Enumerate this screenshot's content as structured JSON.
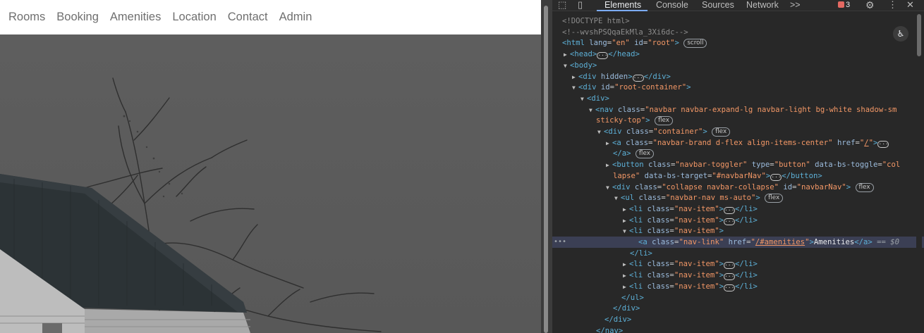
{
  "site": {
    "nav_links": [
      {
        "label": "Rooms"
      },
      {
        "label": "Booking"
      },
      {
        "label": "Amenities"
      },
      {
        "label": "Location"
      },
      {
        "label": "Contact"
      },
      {
        "label": "Admin"
      }
    ]
  },
  "devtools": {
    "tabs": [
      {
        "label": "Elements",
        "active": true
      },
      {
        "label": "Console"
      },
      {
        "label": "Sources"
      },
      {
        "label": "Network"
      },
      {
        "label": ">>"
      }
    ],
    "issues_count": "3",
    "icons": {
      "inspect": "inspect-icon",
      "device": "device-toggle-icon",
      "settings": "gear-icon",
      "more": "kebab-menu-icon",
      "close": "close-icon",
      "accessibility": "accessibility-icon"
    },
    "colors": {
      "selected_row": "#3b3f54",
      "tag": "#5db0d7",
      "attr_name": "#9bbbdc",
      "attr_value": "#f29766",
      "panel_bg": "#282828"
    },
    "tree": [
      {
        "indent": 0,
        "tri": "",
        "html": "<span class='cm'>&lt;!DOCTYPE html&gt;</span>"
      },
      {
        "indent": 0,
        "tri": "",
        "html": "<span class='cm'>&lt;!--wvshPSQqaEkMla_3Xi6dc--&gt;</span>"
      },
      {
        "indent": 0,
        "tri": "",
        "html": "<span class='tg'>&lt;html</span> <span class='an'>lang</span>=<span class='av'>\"en\"</span> <span class='an'>id</span>=<span class='av'>\"root\"</span><span class='tg'>&gt;</span> <span class='pill'>scroll</span>"
      },
      {
        "indent": 1,
        "tri": "▶",
        "html": "<span class='tg'>&lt;head&gt;</span><span class='dots'>···</span><span class='tg'>&lt;/head&gt;</span>"
      },
      {
        "indent": 1,
        "tri": "▼",
        "html": "<span class='tg'>&lt;body&gt;</span>"
      },
      {
        "indent": 2,
        "tri": "▶",
        "html": "<span class='tg'>&lt;div</span> <span class='an'>hidden</span><span class='tg'>&gt;</span><span class='dots'>···</span><span class='tg'>&lt;/div&gt;</span>"
      },
      {
        "indent": 2,
        "tri": "▼",
        "html": "<span class='tg'>&lt;div</span> <span class='an'>id</span>=<span class='av'>\"root-container\"</span><span class='tg'>&gt;</span>"
      },
      {
        "indent": 3,
        "tri": "▼",
        "html": "<span class='tg'>&lt;div&gt;</span>"
      },
      {
        "indent": 4,
        "tri": "▼",
        "html": "<span class='tg'>&lt;nav</span> <span class='an'>class</span>=<span class='av'>\"navbar navbar-expand-lg navbar-light bg-white shadow-sm</span>"
      },
      {
        "indent": 4,
        "tri": "",
        "html": "<span class='av'>sticky-top\"</span><span class='tg'>&gt;</span> <span class='pill'>flex</span>"
      },
      {
        "indent": 5,
        "tri": "▼",
        "html": "<span class='tg'>&lt;div</span> <span class='an'>class</span>=<span class='av'>\"container\"</span><span class='tg'>&gt;</span> <span class='pill'>flex</span>"
      },
      {
        "indent": 6,
        "tri": "▶",
        "html": "<span class='tg'>&lt;a</span> <span class='an'>class</span>=<span class='av'>\"navbar-brand d-flex align-items-center\"</span> <span class='an'>href</span>=<span class='av'>\"</span><span class='lk'>/</span><span class='av'>\"</span><span class='tg'>&gt;</span><span class='dots'>···</span>"
      },
      {
        "indent": 6,
        "tri": "",
        "html": "<span class='tg'>&lt;/a&gt;</span> <span class='pill'>flex</span>"
      },
      {
        "indent": 6,
        "tri": "▶",
        "html": "<span class='tg'>&lt;button</span> <span class='an'>class</span>=<span class='av'>\"navbar-toggler\"</span> <span class='an'>type</span>=<span class='av'>\"button\"</span> <span class='an'>data-bs-toggle</span>=<span class='av'>\"col</span>"
      },
      {
        "indent": 6,
        "tri": "",
        "html": "<span class='av'>lapse\"</span> <span class='an'>data-bs-target</span>=<span class='av'>\"#navbarNav\"</span><span class='tg'>&gt;</span><span class='dots'>···</span><span class='tg'>&lt;/button&gt;</span>"
      },
      {
        "indent": 6,
        "tri": "▼",
        "html": "<span class='tg'>&lt;div</span> <span class='an'>class</span>=<span class='av'>\"collapse navbar-collapse\"</span> <span class='an'>id</span>=<span class='av'>\"navbarNav\"</span><span class='tg'>&gt;</span> <span class='pill'>flex</span>"
      },
      {
        "indent": 7,
        "tri": "▼",
        "html": "<span class='tg'>&lt;ul</span> <span class='an'>class</span>=<span class='av'>\"navbar-nav ms-auto\"</span><span class='tg'>&gt;</span> <span class='pill'>flex</span>"
      },
      {
        "indent": 8,
        "tri": "▶",
        "html": "<span class='tg'>&lt;li</span> <span class='an'>class</span>=<span class='av'>\"nav-item\"</span><span class='tg'>&gt;</span><span class='dots'>···</span><span class='tg'>&lt;/li&gt;</span>"
      },
      {
        "indent": 8,
        "tri": "▶",
        "html": "<span class='tg'>&lt;li</span> <span class='an'>class</span>=<span class='av'>\"nav-item\"</span><span class='tg'>&gt;</span><span class='dots'>···</span><span class='tg'>&lt;/li&gt;</span>"
      },
      {
        "indent": 8,
        "tri": "▼",
        "html": "<span class='tg'>&lt;li</span> <span class='an'>class</span>=<span class='av'>\"nav-item\"</span><span class='tg'>&gt;</span>"
      },
      {
        "indent": 9,
        "tri": "",
        "selected": true,
        "html": "<span class='tg'>&lt;a</span> <span class='an'>class</span>=<span class='av'>\"nav-link\"</span> <span class='an'>href</span>=<span class='av'>\"</span><span class='lk'>/#amenities</span><span class='av'>\"</span><span class='tg'>&gt;</span><span class='tx'>Amenities</span><span class='tg'>&lt;/a&gt;</span> <span class='eq'>== $0</span>"
      },
      {
        "indent": 8,
        "tri": "",
        "html": "<span class='tg'>&lt;/li&gt;</span>"
      },
      {
        "indent": 8,
        "tri": "▶",
        "html": "<span class='tg'>&lt;li</span> <span class='an'>class</span>=<span class='av'>\"nav-item\"</span><span class='tg'>&gt;</span><span class='dots'>···</span><span class='tg'>&lt;/li&gt;</span>"
      },
      {
        "indent": 8,
        "tri": "▶",
        "html": "<span class='tg'>&lt;li</span> <span class='an'>class</span>=<span class='av'>\"nav-item\"</span><span class='tg'>&gt;</span><span class='dots'>···</span><span class='tg'>&lt;/li&gt;</span>"
      },
      {
        "indent": 8,
        "tri": "▶",
        "html": "<span class='tg'>&lt;li</span> <span class='an'>class</span>=<span class='av'>\"nav-item\"</span><span class='tg'>&gt;</span><span class='dots'>···</span><span class='tg'>&lt;/li&gt;</span>"
      },
      {
        "indent": 7,
        "tri": "",
        "html": "<span class='tg'>&lt;/ul&gt;</span>"
      },
      {
        "indent": 6,
        "tri": "",
        "html": "<span class='tg'>&lt;/div&gt;</span>"
      },
      {
        "indent": 5,
        "tri": "",
        "html": "<span class='tg'>&lt;/div&gt;</span>"
      },
      {
        "indent": 4,
        "tri": "",
        "html": "<span class='tg'>&lt;/nav&gt;</span>"
      }
    ]
  }
}
